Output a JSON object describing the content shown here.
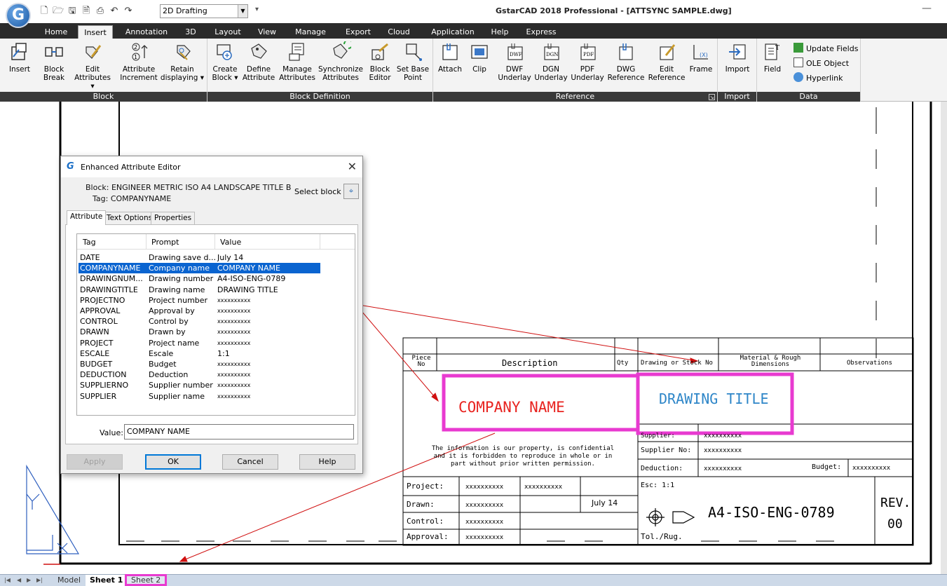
{
  "app": {
    "logo": "G",
    "workspace": "2D Drafting",
    "window_title": "GstarCAD 2018 Professional - [ATTSYNC SAMPLE.dwg]"
  },
  "ribbon_tabs": [
    "Home",
    "Insert",
    "Annotation",
    "3D",
    "Layout",
    "View",
    "Manage",
    "Export",
    "Cloud",
    "Application",
    "Help",
    "Express"
  ],
  "ribbon": {
    "block": {
      "label": "Block",
      "insert": "Insert",
      "block_break_1": "Block",
      "block_break_2": "Break",
      "edit_attributes_1": "Edit",
      "edit_attributes_2": "Attributes",
      "attr_increment_1": "Attribute",
      "attr_increment_2": "Increment",
      "retain_1": "Retain",
      "retain_2": "displaying"
    },
    "block_definition": {
      "label": "Block Definition",
      "create_1": "Create",
      "create_2": "Block",
      "define_1": "Define",
      "define_2": "Attribute",
      "manage_1": "Manage",
      "manage_2": "Attributes",
      "sync_1": "Synchronize",
      "sync_2": "Attributes",
      "block_editor_1": "Block",
      "block_editor_2": "Editor",
      "set_base_1": "Set Base",
      "set_base_2": "Point"
    },
    "reference": {
      "label": "Reference",
      "attach": "Attach",
      "clip": "Clip",
      "dwf_1": "DWF",
      "dwf_2": "Underlay",
      "dgn_1": "DGN",
      "dgn_2": "Underlay",
      "pdf_1": "PDF",
      "pdf_2": "Underlay",
      "dwg_1": "DWG",
      "dwg_2": "Reference",
      "edit_1": "Edit",
      "edit_2": "Reference",
      "frame": "Frame"
    },
    "import": {
      "label": "Import",
      "import_btn": "Import"
    },
    "data": {
      "label": "Data",
      "field": "Field",
      "update_fields": "Update Fields",
      "ole_object": "OLE Object",
      "hyperlink": "Hyperlink"
    }
  },
  "dialog": {
    "title": "Enhanced Attribute Editor",
    "block_line": "Block: ENGINEER METRIC ISO A4 LANDSCAPE TITLE B",
    "tag_line": "Tag: COMPANYNAME",
    "select_block": "Select block",
    "tabs": [
      "Attribute",
      "Text Options",
      "Properties"
    ],
    "columns": [
      "Tag",
      "Prompt",
      "Value"
    ],
    "rows": [
      {
        "tag": "DATE",
        "prompt": "Drawing save d...",
        "value": "July 14"
      },
      {
        "tag": "COMPANYNAME",
        "prompt": "Company name",
        "value": "COMPANY NAME"
      },
      {
        "tag": "DRAWINGNUM...",
        "prompt": "Drawing number",
        "value": "A4-ISO-ENG-0789"
      },
      {
        "tag": "DRAWINGTITLE",
        "prompt": "Drawing name",
        "value": "DRAWING TITLE"
      },
      {
        "tag": "PROJECTNO",
        "prompt": "Project number",
        "value": "xxxxxxxxxx"
      },
      {
        "tag": "APPROVAL",
        "prompt": "Approval by",
        "value": "xxxxxxxxxx"
      },
      {
        "tag": "CONTROL",
        "prompt": "Control by",
        "value": "xxxxxxxxxx"
      },
      {
        "tag": "DRAWN",
        "prompt": "Drawn by",
        "value": "xxxxxxxxxx"
      },
      {
        "tag": "PROJECT",
        "prompt": "Project name",
        "value": "xxxxxxxxxx"
      },
      {
        "tag": "ESCALE",
        "prompt": "Escale",
        "value": "1:1"
      },
      {
        "tag": "BUDGET",
        "prompt": "Budget",
        "value": "xxxxxxxxxx"
      },
      {
        "tag": "DEDUCTION",
        "prompt": "Deduction",
        "value": "xxxxxxxxxx"
      },
      {
        "tag": "SUPPLIERNO",
        "prompt": "Supplier number",
        "value": "xxxxxxxxxx"
      },
      {
        "tag": "SUPPLIER",
        "prompt": "Supplier name",
        "value": "xxxxxxxxxx"
      }
    ],
    "value_label": "Value:",
    "value": "COMPANY NAME",
    "buttons": {
      "apply": "Apply",
      "ok": "OK",
      "cancel": "Cancel",
      "help": "Help"
    }
  },
  "title_block": {
    "piece_no_1": "Piece",
    "piece_no_2": "No",
    "description": "Description",
    "qty": "Qty",
    "drawing_stock": "Drawing or Stock No",
    "material_1": "Material & Rough",
    "material_2": "Dimensions",
    "observations": "Observations",
    "company_name": "COMPANY NAME",
    "drawing_title": "DRAWING TITLE",
    "supplier_label": "Supplier:",
    "supplier_value": "xxxxxxxxxx",
    "supplier_no_label": "Supplier No:",
    "supplier_no_value": "xxxxxxxxxx",
    "deduction_label": "Deduction:",
    "deduction_value": "xxxxxxxxxx",
    "budget_label": "Budget:",
    "budget_value": "xxxxxxxxxx",
    "notice_1": "The information is our property, is confidential",
    "notice_2": "and it is forbidden to reproduce in whole or in",
    "notice_3": "part without prior written permission.",
    "project_label": "Project:",
    "project_no": "xxxxxxxxxx",
    "project_name": "xxxxxxxxxx",
    "drawn_label": "Drawn:",
    "drawn_value": "xxxxxxxxxx",
    "date": "July 14",
    "control_label": "Control:",
    "control_value": "xxxxxxxxxx",
    "approval_label": "Approval:",
    "approval_value": "xxxxxxxxxx",
    "escale": "Esc: 1:1",
    "drawing_number": "A4-ISO-ENG-0789",
    "rev_label": "REV.",
    "rev_value": "00",
    "tol": "Tol./Rug."
  },
  "sheets": [
    "Model",
    "Sheet 1",
    "Sheet 2"
  ],
  "colors": {
    "highlight": "#e83ad0",
    "company_name": "#e8231f",
    "drawing_title": "#2e86c8",
    "ribbon_dark": "#2b2b2b",
    "selection": "#0a64d0",
    "arrow": "#d01010"
  }
}
